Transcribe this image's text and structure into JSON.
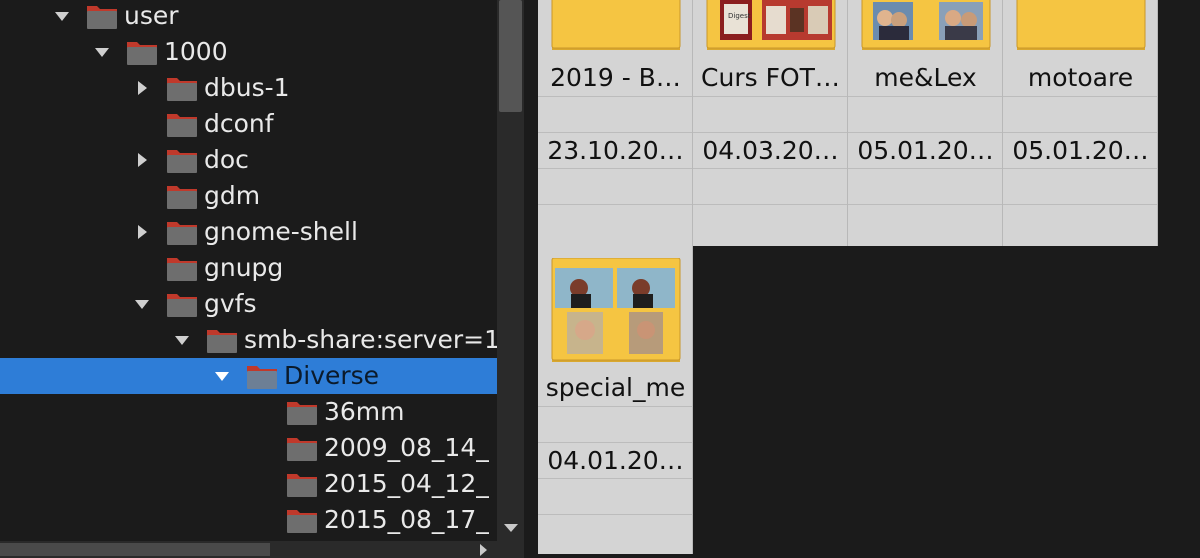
{
  "tree": {
    "items": [
      {
        "label": "user",
        "arrow": "down",
        "level": 1
      },
      {
        "label": "1000",
        "arrow": "down",
        "level": 2
      },
      {
        "label": "dbus-1",
        "arrow": "right",
        "level": 3
      },
      {
        "label": "dconf",
        "arrow": "none",
        "level": 3
      },
      {
        "label": "doc",
        "arrow": "right",
        "level": 3
      },
      {
        "label": "gdm",
        "arrow": "none",
        "level": 3
      },
      {
        "label": "gnome-shell",
        "arrow": "right",
        "level": 3
      },
      {
        "label": "gnupg",
        "arrow": "none",
        "level": 3
      },
      {
        "label": "gvfs",
        "arrow": "down",
        "level": 3
      },
      {
        "label": "smb-share:server=1",
        "arrow": "down",
        "level": 4
      },
      {
        "label": "Diverse",
        "arrow": "down",
        "level": 5,
        "selected": true
      },
      {
        "label": "36mm",
        "arrow": "none",
        "level": 6
      },
      {
        "label": "2009_08_14_",
        "arrow": "none",
        "level": 6
      },
      {
        "label": "2015_04_12_",
        "arrow": "none",
        "level": 6
      },
      {
        "label": "2015_08_17_",
        "arrow": "none",
        "level": 6
      }
    ]
  },
  "grid": {
    "tiles": [
      {
        "name": "2019 - B…",
        "date": "23.10.20…",
        "thumb": "plain"
      },
      {
        "name": "Curs FOT…",
        "date": "04.03.20…",
        "thumb": "store"
      },
      {
        "name": "me&Lex",
        "date": "05.01.20…",
        "thumb": "people"
      },
      {
        "name": "motoare",
        "date": "05.01.20…",
        "thumb": "plain"
      },
      {
        "name": "special_me",
        "date": "04.01.20…",
        "thumb": "collage"
      }
    ]
  },
  "colors": {
    "selection": "#2e7dd7",
    "folder_dark": "#6e6e6e",
    "folder_tab": "#c0392b",
    "folder_yellow": "#f5c542",
    "tile_bg": "#d4d4d4"
  },
  "icons": {
    "tree_folder": "folder-icon",
    "expand": "expander-icon",
    "grid_folder": "folder-thumbnail-icon"
  }
}
